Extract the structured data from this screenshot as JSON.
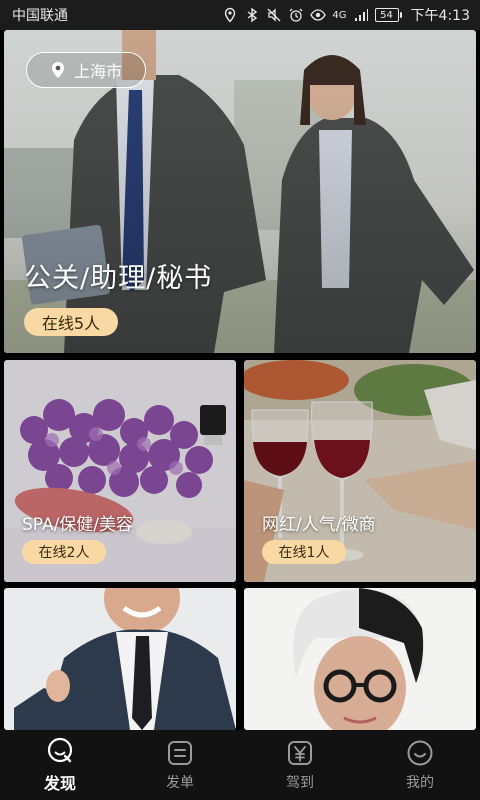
{
  "status_bar": {
    "carrier": "中国联通",
    "network": "4G",
    "battery": "54",
    "time": "下午4:13"
  },
  "location": {
    "city": "上海市",
    "icon": "location-pin-icon"
  },
  "cards": [
    {
      "title": "公关/助理/秘书",
      "online": "在线5人"
    },
    {
      "title": "SPA/保健/美容",
      "online": "在线2人"
    },
    {
      "title": "网红/人气/微商",
      "online": "在线1人"
    }
  ],
  "bottom_nav": [
    {
      "label": "发现",
      "icon": "discover-icon",
      "active": true
    },
    {
      "label": "发单",
      "icon": "post-order-icon",
      "active": false
    },
    {
      "label": "驾到",
      "icon": "yuan-icon",
      "active": false
    },
    {
      "label": "我的",
      "icon": "profile-icon",
      "active": false
    }
  ],
  "colors": {
    "badge_bg": "#f8d9a4",
    "nav_bg": "#121212",
    "status_bg": "#1c1c1c"
  }
}
